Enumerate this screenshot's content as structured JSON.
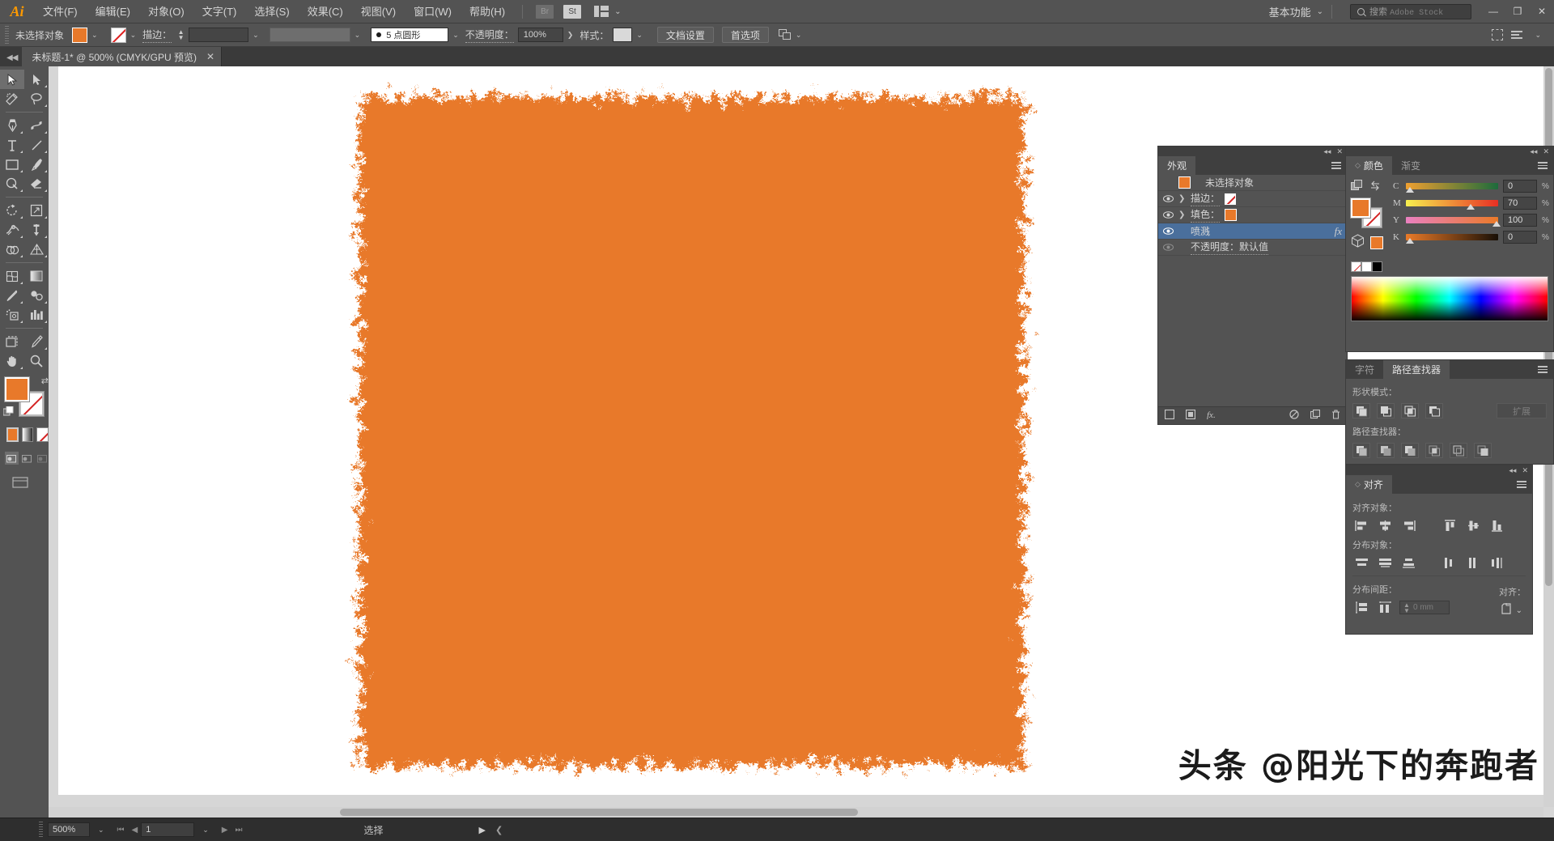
{
  "app": {
    "logo": "Ai"
  },
  "menubar": {
    "items": [
      {
        "label": "文件(F)"
      },
      {
        "label": "编辑(E)"
      },
      {
        "label": "对象(O)"
      },
      {
        "label": "文字(T)"
      },
      {
        "label": "选择(S)"
      },
      {
        "label": "效果(C)"
      },
      {
        "label": "视图(V)"
      },
      {
        "label": "窗口(W)"
      },
      {
        "label": "帮助(H)"
      }
    ],
    "bridge_label": "Br",
    "stock_label": "St",
    "workspace_label": "基本功能",
    "search_placeholder": "搜索",
    "search_stock": "Adobe Stock",
    "window_buttons": {
      "minimize": "—",
      "restore": "❐",
      "close": "✕"
    }
  },
  "controlbar": {
    "selection_label": "未选择对象",
    "fill_color": "#e8792a",
    "stroke_label": "描边：",
    "stroke_weight": "",
    "stroke_profile": "",
    "brush_label": "5 点圆形",
    "opacity_label": "不透明度：",
    "opacity_value": "100%",
    "style_label": "样式：",
    "doc_setup_button": "文档设置",
    "prefs_button": "首选项"
  },
  "doctab": {
    "title": "未标题-1* @ 500% (CMYK/GPU 预览)",
    "close": "✕"
  },
  "toolbar": {
    "tools": [
      {
        "name": "selection-tool",
        "selected": true
      },
      {
        "name": "direct-selection-tool",
        "selected": false
      },
      {
        "name": "magic-wand-tool",
        "selected": false
      },
      {
        "name": "lasso-tool",
        "selected": false
      },
      {
        "name": "pen-tool",
        "selected": false
      },
      {
        "name": "curvature-tool",
        "selected": false
      },
      {
        "name": "type-tool",
        "selected": false
      },
      {
        "name": "line-segment-tool",
        "selected": false
      },
      {
        "name": "rectangle-tool",
        "selected": false
      },
      {
        "name": "paintbrush-tool",
        "selected": false
      },
      {
        "name": "shaper-tool",
        "selected": false
      },
      {
        "name": "eraser-tool",
        "selected": false
      },
      {
        "name": "rotate-tool",
        "selected": false
      },
      {
        "name": "scale-tool",
        "selected": false
      },
      {
        "name": "width-tool",
        "selected": false
      },
      {
        "name": "free-transform-tool",
        "selected": false
      },
      {
        "name": "shape-builder-tool",
        "selected": false
      },
      {
        "name": "perspective-grid-tool",
        "selected": false
      },
      {
        "name": "mesh-tool",
        "selected": false
      },
      {
        "name": "gradient-tool",
        "selected": false
      },
      {
        "name": "eyedropper-tool",
        "selected": false
      },
      {
        "name": "blend-tool",
        "selected": false
      },
      {
        "name": "symbol-sprayer-tool",
        "selected": false
      },
      {
        "name": "column-graph-tool",
        "selected": false
      },
      {
        "name": "artboard-tool",
        "selected": false
      },
      {
        "name": "slice-tool",
        "selected": false
      },
      {
        "name": "hand-tool",
        "selected": false
      },
      {
        "name": "zoom-tool",
        "selected": false
      }
    ],
    "fill_color": "#e8792a",
    "stroke_color": "none"
  },
  "panels": {
    "appearance": {
      "tab_label": "外观",
      "rows": [
        {
          "label": "未选择对象",
          "kind": "object",
          "eye": false,
          "expand": false,
          "swatch": "#e8792a"
        },
        {
          "label": "描边：",
          "kind": "stroke",
          "eye": true,
          "expand": true,
          "swatch": "none"
        },
        {
          "label": "填色：",
          "kind": "fill",
          "eye": true,
          "expand": true,
          "swatch": "#e8792a"
        },
        {
          "label": "喷溅",
          "kind": "effect",
          "eye": true,
          "expand": false,
          "selected": true,
          "fx": "fx"
        },
        {
          "label": "不透明度：默认值",
          "kind": "opacity",
          "eye": true,
          "dim": true,
          "expand": false
        }
      ]
    },
    "color": {
      "tabs": [
        {
          "label": "颜色",
          "active": true
        },
        {
          "label": "渐变",
          "active": false
        }
      ],
      "sliders": [
        {
          "label": "C",
          "value": "0",
          "unit": "%",
          "pos": 0,
          "from": "#f5a623",
          "to": "#1e6b3a"
        },
        {
          "label": "M",
          "value": "70",
          "unit": "%",
          "pos": 70,
          "from": "#f3e74a",
          "to": "#e8312a"
        },
        {
          "label": "Y",
          "value": "100",
          "unit": "%",
          "pos": 100,
          "from": "#e877b6",
          "to": "#e8792a"
        },
        {
          "label": "K",
          "value": "0",
          "unit": "%",
          "pos": 0,
          "from": "#e8792a",
          "to": "#1a1008"
        }
      ]
    },
    "pathfinder": {
      "tabs": [
        {
          "label": "字符",
          "active": false
        },
        {
          "label": "路径查找器",
          "active": true
        }
      ],
      "shape_modes_label": "形状模式：",
      "expand_label": "扩展",
      "pathfinders_label": "路径查找器：",
      "shape_modes": [
        "unite",
        "minus-front",
        "intersect",
        "exclude"
      ],
      "pathfinders": [
        "divide",
        "trim",
        "merge",
        "crop",
        "outline",
        "minus-back"
      ]
    },
    "align": {
      "tab_label": "对齐",
      "align_objects_label": "对齐对象：",
      "distribute_objects_label": "分布对象：",
      "distribute_spacing_label": "分布间距：",
      "align_to_label": "对齐：",
      "spacing_value": "0 mm",
      "align_buttons": [
        "align-left",
        "align-h-center",
        "align-right",
        "align-top",
        "align-v-center",
        "align-bottom"
      ],
      "distribute_buttons": [
        "dist-top",
        "dist-v-center",
        "dist-bottom",
        "dist-left",
        "dist-h-center",
        "dist-right"
      ],
      "spacing_buttons": [
        "v-distribute-space",
        "h-distribute-space"
      ]
    }
  },
  "statusbar": {
    "zoom": "500%",
    "page": "1",
    "status_text": "选择"
  },
  "watermark": {
    "text": "头条 @阳光下的奔跑者"
  },
  "artwork": {
    "fill_color": "#e8792a",
    "effect": "喷溅"
  }
}
